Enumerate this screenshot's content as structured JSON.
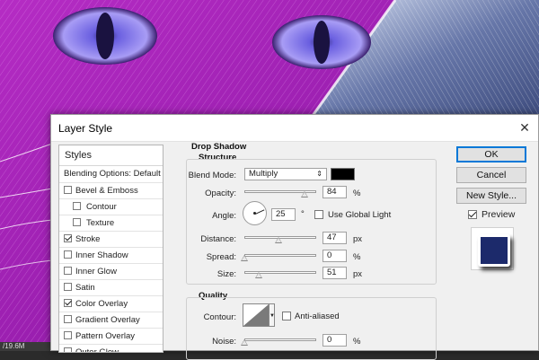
{
  "canvas": {
    "status_text": "/19.6M"
  },
  "dialog": {
    "title": "Layer Style",
    "close_glyph": "✕",
    "styles_header": "Styles",
    "blending_options": "Blending Options: Default",
    "style_items": [
      {
        "label": "Bevel & Emboss",
        "checked": false,
        "level": 1
      },
      {
        "label": "Contour",
        "checked": false,
        "level": 2
      },
      {
        "label": "Texture",
        "checked": false,
        "level": 2
      },
      {
        "label": "Stroke",
        "checked": true,
        "level": 1
      },
      {
        "label": "Inner Shadow",
        "checked": false,
        "level": 1
      },
      {
        "label": "Inner Glow",
        "checked": false,
        "level": 1
      },
      {
        "label": "Satin",
        "checked": false,
        "level": 1
      },
      {
        "label": "Color Overlay",
        "checked": true,
        "level": 1
      },
      {
        "label": "Gradient Overlay",
        "checked": false,
        "level": 1
      },
      {
        "label": "Pattern Overlay",
        "checked": false,
        "level": 1
      },
      {
        "label": "Outer Glow",
        "checked": false,
        "level": 1
      }
    ],
    "drop_shadow": {
      "section_title": "Drop Shadow",
      "structure_title": "Structure",
      "blend_mode_label": "Blend Mode:",
      "blend_mode_value": "Multiply",
      "shadow_color": "#000000",
      "opacity_label": "Opacity:",
      "opacity_value": "84",
      "opacity_level": 0.84,
      "opacity_unit": "%",
      "angle_label": "Angle:",
      "angle_value": "25",
      "angle_unit": "°",
      "global_light_label": "Use Global Light",
      "global_light_checked": false,
      "distance_label": "Distance:",
      "distance_value": "47",
      "distance_level": 0.47,
      "distance_unit": "px",
      "spread_label": "Spread:",
      "spread_value": "0",
      "spread_level": 0.0,
      "spread_unit": "%",
      "size_label": "Size:",
      "size_value": "51",
      "size_level": 0.2,
      "size_unit": "px"
    },
    "quality": {
      "section_title": "Quality",
      "contour_label": "Contour:",
      "anti_aliased_label": "Anti-aliased",
      "anti_aliased_checked": false,
      "noise_label": "Noise:",
      "noise_value": "0",
      "noise_level": 0.0,
      "noise_unit": "%"
    },
    "buttons": {
      "ok": "OK",
      "cancel": "Cancel",
      "new_style": "New Style...",
      "preview_label": "Preview",
      "preview_checked": true
    },
    "colors": {
      "preview_fill": "#1c2a6b",
      "default_button_border": "#0078d7"
    }
  }
}
